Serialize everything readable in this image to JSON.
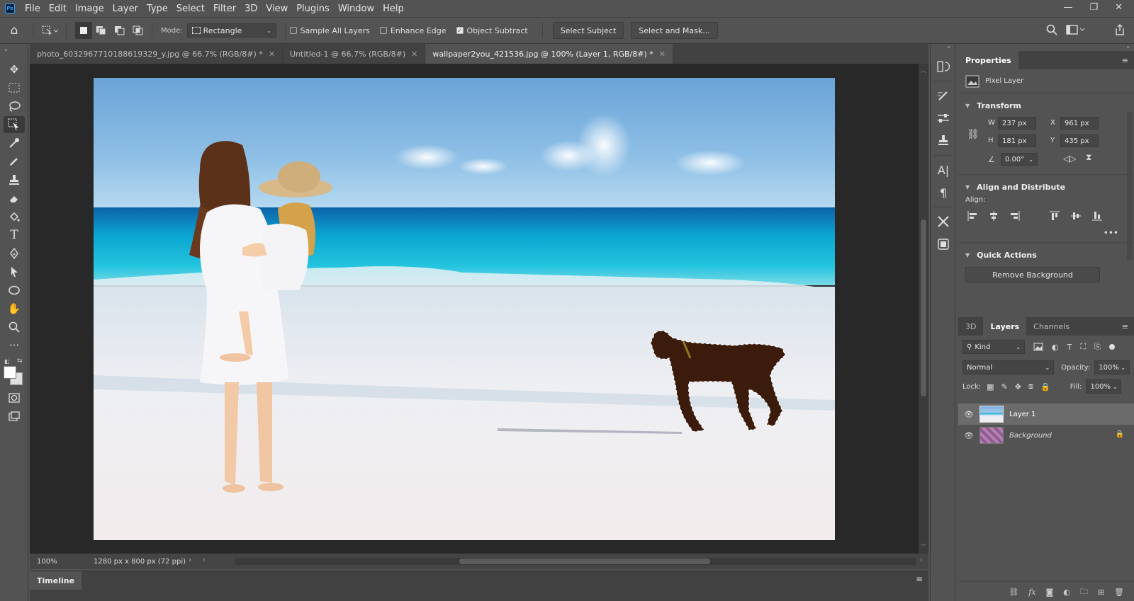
{
  "menu": [
    "File",
    "Edit",
    "Image",
    "Layer",
    "Type",
    "Select",
    "Filter",
    "3D",
    "View",
    "Plugins",
    "Window",
    "Help"
  ],
  "app_logo": "Ps",
  "options": {
    "mode_label": "Mode:",
    "mode_value": "Rectangle",
    "sample_all_layers": "Sample All Layers",
    "enhance_edge": "Enhance Edge",
    "object_subtract": "Object Subtract",
    "select_subject": "Select Subject",
    "select_and_mask": "Select and Mask..."
  },
  "tabs": [
    {
      "label": "photo_6032967710188619329_y.jpg @ 66.7% (RGB/8#) *",
      "active": false
    },
    {
      "label": "Untitled-1 @ 66.7% (RGB/8#)",
      "active": false
    },
    {
      "label": "wallpaper2you_421536.jpg @ 100% (Layer 1, RGB/8#) *",
      "active": true
    }
  ],
  "status": {
    "zoom": "100%",
    "doc_info": "1280 px x 800 px (72 ppi)"
  },
  "timeline_label": "Timeline",
  "properties": {
    "tab_label": "Properties",
    "layer_type": "Pixel Layer",
    "transform": {
      "title": "Transform",
      "w_label": "W",
      "w": "237 px",
      "h_label": "H",
      "h": "181 px",
      "x_label": "X",
      "x": "961 px",
      "y_label": "Y",
      "y": "435 px",
      "angle": "0.00°"
    },
    "align": {
      "title": "Align and Distribute",
      "label": "Align:"
    },
    "quick_actions": {
      "title": "Quick Actions",
      "button": "Remove Background"
    }
  },
  "layers_panel": {
    "tabs": [
      "3D",
      "Layers",
      "Channels"
    ],
    "filter_kind": "Kind",
    "blend_mode": "Normal",
    "opacity_label": "Opacity:",
    "opacity": "100%",
    "lock_label": "Lock:",
    "fill_label": "Fill:",
    "fill": "100%",
    "layers": [
      {
        "name": "Layer 1",
        "selected": true
      },
      {
        "name": "Background",
        "selected": false
      }
    ]
  },
  "colors": {
    "accent": "#31a8ff",
    "panel": "#535353",
    "dark": "#282828"
  }
}
